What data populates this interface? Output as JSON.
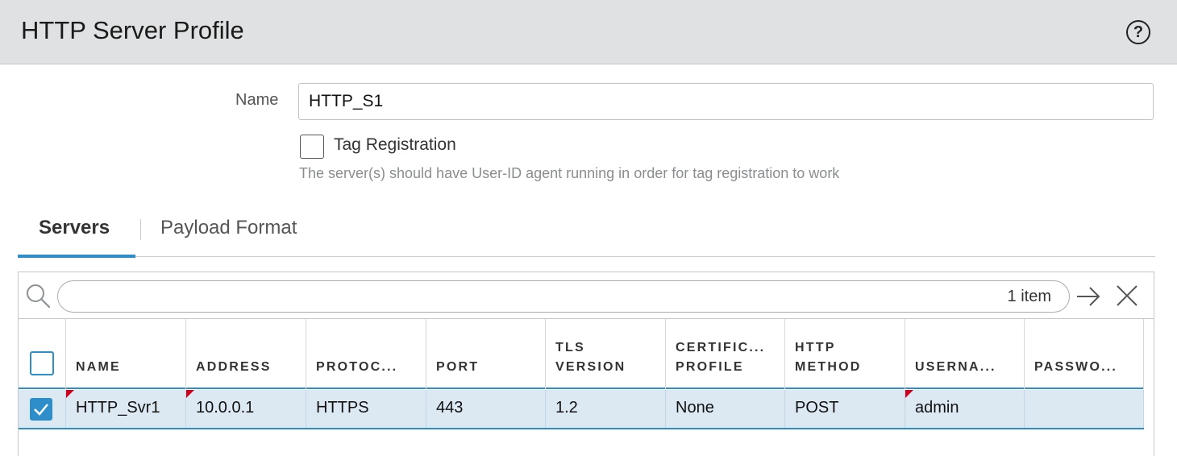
{
  "dialog": {
    "title": "HTTP Server Profile",
    "help_glyph": "?"
  },
  "form": {
    "name_label": "Name",
    "name_value": "HTTP_S1",
    "tag_registration_label": "Tag Registration",
    "tag_registration_checked": false,
    "tag_help": "The server(s) should have User-ID agent running in order for tag registration to work"
  },
  "tabs": [
    {
      "label": "Servers",
      "active": true
    },
    {
      "label": "Payload Format",
      "active": false
    }
  ],
  "grid": {
    "search_value": "",
    "item_count": "1 item",
    "columns": [
      [
        "NAME"
      ],
      [
        "ADDRESS"
      ],
      [
        "PROTOC..."
      ],
      [
        "PORT"
      ],
      [
        "TLS",
        "VERSION"
      ],
      [
        "CERTIFIC...",
        "PROFILE"
      ],
      [
        "HTTP",
        "METHOD"
      ],
      [
        "USERNA..."
      ],
      [
        "PASSWO..."
      ]
    ],
    "rows": [
      {
        "selected": true,
        "cells": [
          "HTTP_Svr1",
          "10.0.0.1",
          "HTTPS",
          "443",
          "1.2",
          "None",
          "POST",
          "admin",
          ""
        ],
        "flagged": [
          0,
          1,
          7
        ]
      }
    ]
  },
  "colors": {
    "accent": "#2e8ec9",
    "selected_row": "#dce9f3",
    "flag": "#d0021b",
    "titlebar": "#e0e1e2"
  },
  "icons": {
    "help": "help-circle-icon",
    "search": "search-icon",
    "go": "arrow-right-icon",
    "clear": "close-icon",
    "checkmark": "checkmark-icon"
  }
}
